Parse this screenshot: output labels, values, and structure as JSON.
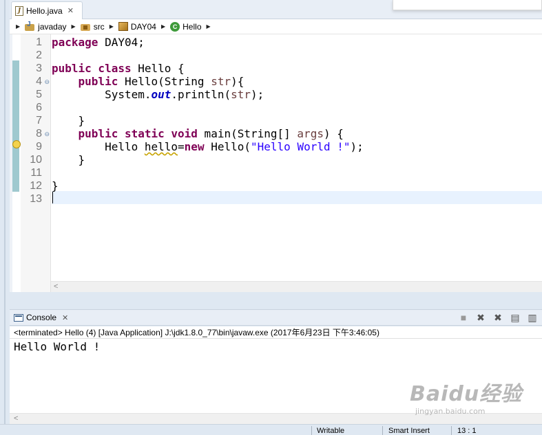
{
  "editor": {
    "tab": {
      "title": "Hello.java",
      "close": "✕"
    },
    "breadcrumb": [
      "javaday",
      "src",
      "DAY04",
      "Hello"
    ],
    "line_numbers": [
      "1",
      "2",
      "3",
      "4",
      "5",
      "6",
      "7",
      "8",
      "9",
      "10",
      "11",
      "12",
      "13"
    ]
  },
  "console": {
    "tab_title": "Console",
    "close": "✕",
    "info": "<terminated> Hello (4) [Java Application] J:\\jdk1.8.0_77\\bin\\javaw.exe (2017年6月23日 下午3:46:05)",
    "output": "Hello World !"
  },
  "statusbar": {
    "writable": "Writable",
    "insert_mode": "Smart Insert",
    "position": "13 : 1"
  },
  "watermark": {
    "main": "Baidu经验",
    "sub": "jingyan.baidu.com"
  },
  "colors": {
    "keyword": "#7f0055",
    "string": "#2a00ff",
    "field": "#0000c0",
    "change_bar": "#9fc9cf"
  }
}
